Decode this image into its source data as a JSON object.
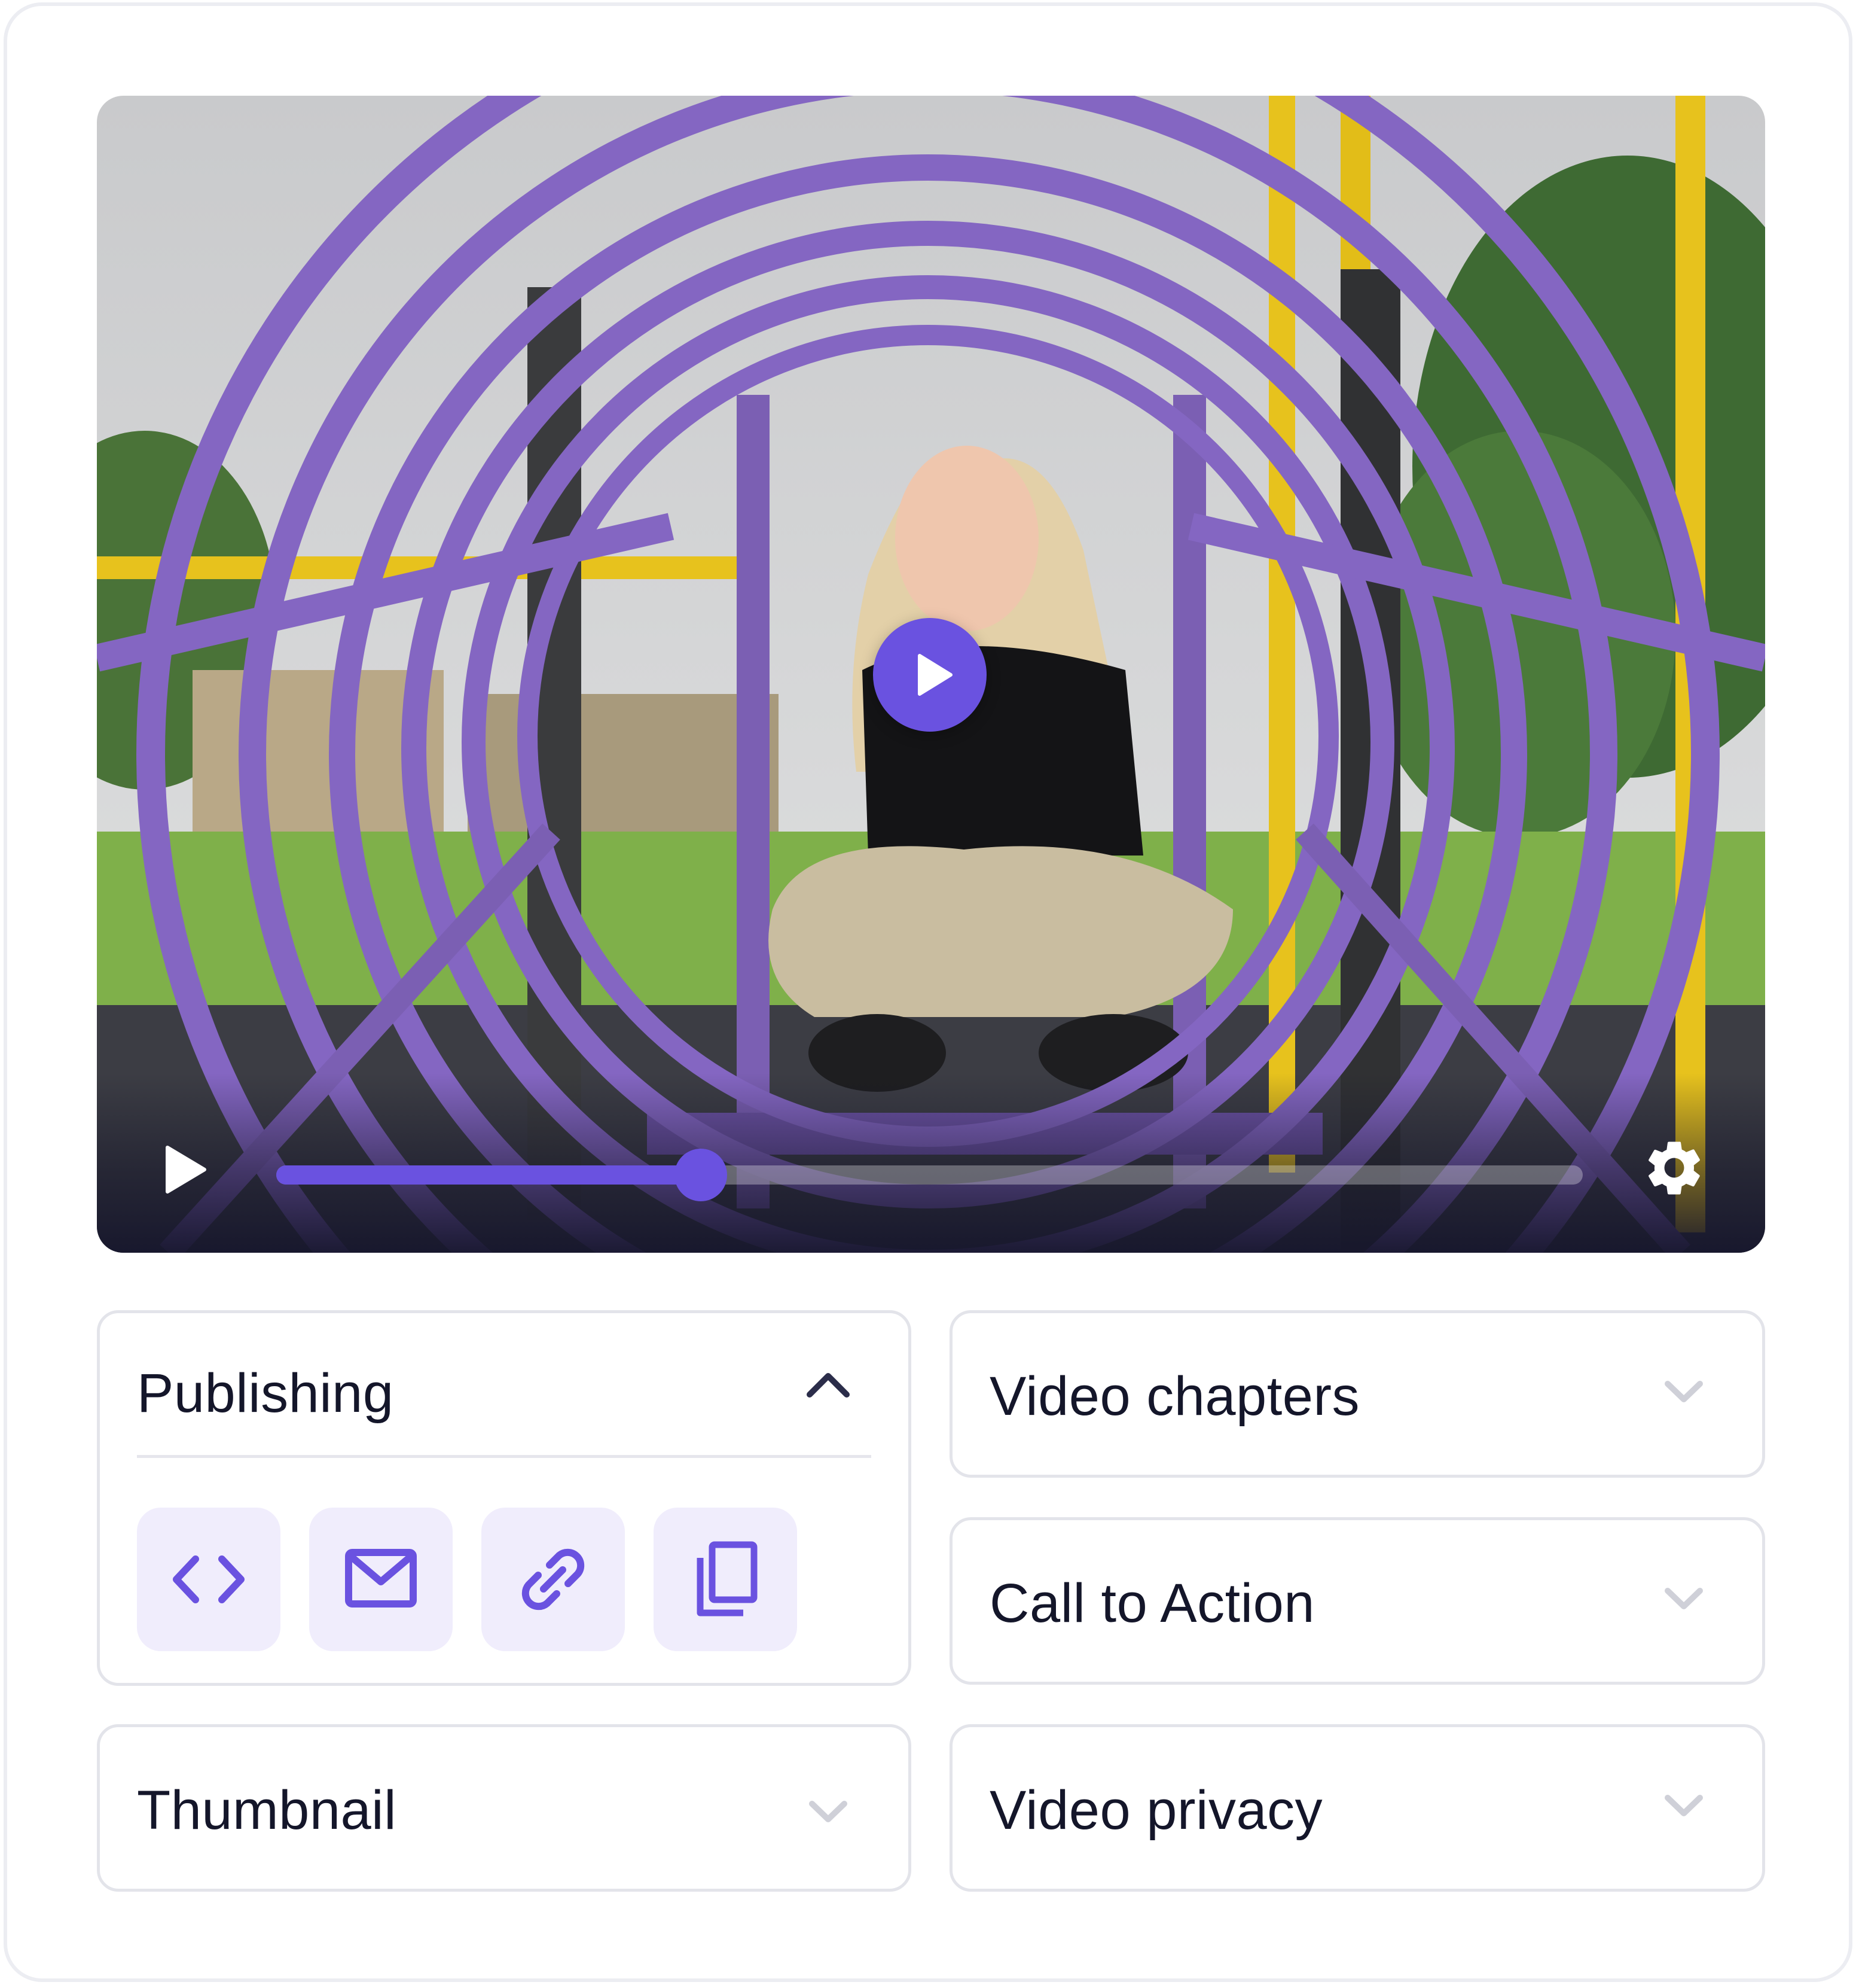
{
  "video": {
    "progress_fraction": 0.325,
    "accent_color": "#6a52e0",
    "icons": [
      "play-icon",
      "settings-gear-icon"
    ]
  },
  "panels": {
    "publishing": {
      "title": "Publishing",
      "expanded": true,
      "actions": [
        {
          "name": "embed-code",
          "icon": "code-brackets-icon"
        },
        {
          "name": "email",
          "icon": "envelope-icon"
        },
        {
          "name": "copy-link",
          "icon": "link-icon"
        },
        {
          "name": "copy",
          "icon": "copy-icon"
        }
      ]
    },
    "video_chapters": {
      "title": "Video chapters",
      "expanded": false
    },
    "call_to_action": {
      "title": "Call to Action",
      "expanded": false
    },
    "thumbnail": {
      "title": "Thumbnail",
      "expanded": false
    },
    "video_privacy": {
      "title": "Video privacy",
      "expanded": false
    }
  }
}
